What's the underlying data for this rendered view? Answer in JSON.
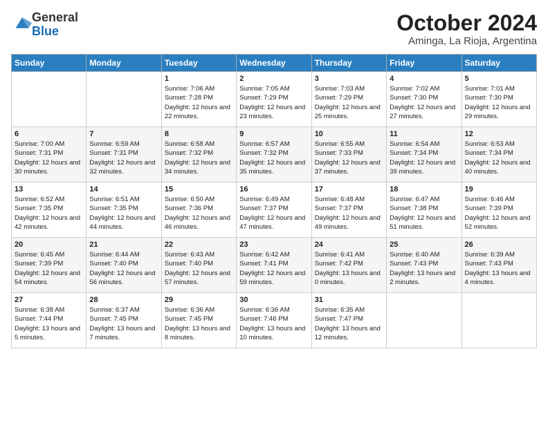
{
  "logo": {
    "general": "General",
    "blue": "Blue"
  },
  "title": "October 2024",
  "subtitle": "Aminga, La Rioja, Argentina",
  "days_of_week": [
    "Sunday",
    "Monday",
    "Tuesday",
    "Wednesday",
    "Thursday",
    "Friday",
    "Saturday"
  ],
  "weeks": [
    [
      {
        "day": "",
        "sunrise": "",
        "sunset": "",
        "daylight": ""
      },
      {
        "day": "",
        "sunrise": "",
        "sunset": "",
        "daylight": ""
      },
      {
        "day": "1",
        "sunrise": "Sunrise: 7:06 AM",
        "sunset": "Sunset: 7:28 PM",
        "daylight": "Daylight: 12 hours and 22 minutes."
      },
      {
        "day": "2",
        "sunrise": "Sunrise: 7:05 AM",
        "sunset": "Sunset: 7:29 PM",
        "daylight": "Daylight: 12 hours and 23 minutes."
      },
      {
        "day": "3",
        "sunrise": "Sunrise: 7:03 AM",
        "sunset": "Sunset: 7:29 PM",
        "daylight": "Daylight: 12 hours and 25 minutes."
      },
      {
        "day": "4",
        "sunrise": "Sunrise: 7:02 AM",
        "sunset": "Sunset: 7:30 PM",
        "daylight": "Daylight: 12 hours and 27 minutes."
      },
      {
        "day": "5",
        "sunrise": "Sunrise: 7:01 AM",
        "sunset": "Sunset: 7:30 PM",
        "daylight": "Daylight: 12 hours and 29 minutes."
      }
    ],
    [
      {
        "day": "6",
        "sunrise": "Sunrise: 7:00 AM",
        "sunset": "Sunset: 7:31 PM",
        "daylight": "Daylight: 12 hours and 30 minutes."
      },
      {
        "day": "7",
        "sunrise": "Sunrise: 6:59 AM",
        "sunset": "Sunset: 7:31 PM",
        "daylight": "Daylight: 12 hours and 32 minutes."
      },
      {
        "day": "8",
        "sunrise": "Sunrise: 6:58 AM",
        "sunset": "Sunset: 7:32 PM",
        "daylight": "Daylight: 12 hours and 34 minutes."
      },
      {
        "day": "9",
        "sunrise": "Sunrise: 6:57 AM",
        "sunset": "Sunset: 7:32 PM",
        "daylight": "Daylight: 12 hours and 35 minutes."
      },
      {
        "day": "10",
        "sunrise": "Sunrise: 6:55 AM",
        "sunset": "Sunset: 7:33 PM",
        "daylight": "Daylight: 12 hours and 37 minutes."
      },
      {
        "day": "11",
        "sunrise": "Sunrise: 6:54 AM",
        "sunset": "Sunset: 7:34 PM",
        "daylight": "Daylight: 12 hours and 39 minutes."
      },
      {
        "day": "12",
        "sunrise": "Sunrise: 6:53 AM",
        "sunset": "Sunset: 7:34 PM",
        "daylight": "Daylight: 12 hours and 40 minutes."
      }
    ],
    [
      {
        "day": "13",
        "sunrise": "Sunrise: 6:52 AM",
        "sunset": "Sunset: 7:35 PM",
        "daylight": "Daylight: 12 hours and 42 minutes."
      },
      {
        "day": "14",
        "sunrise": "Sunrise: 6:51 AM",
        "sunset": "Sunset: 7:35 PM",
        "daylight": "Daylight: 12 hours and 44 minutes."
      },
      {
        "day": "15",
        "sunrise": "Sunrise: 6:50 AM",
        "sunset": "Sunset: 7:36 PM",
        "daylight": "Daylight: 12 hours and 46 minutes."
      },
      {
        "day": "16",
        "sunrise": "Sunrise: 6:49 AM",
        "sunset": "Sunset: 7:37 PM",
        "daylight": "Daylight: 12 hours and 47 minutes."
      },
      {
        "day": "17",
        "sunrise": "Sunrise: 6:48 AM",
        "sunset": "Sunset: 7:37 PM",
        "daylight": "Daylight: 12 hours and 49 minutes."
      },
      {
        "day": "18",
        "sunrise": "Sunrise: 6:47 AM",
        "sunset": "Sunset: 7:38 PM",
        "daylight": "Daylight: 12 hours and 51 minutes."
      },
      {
        "day": "19",
        "sunrise": "Sunrise: 6:46 AM",
        "sunset": "Sunset: 7:39 PM",
        "daylight": "Daylight: 12 hours and 52 minutes."
      }
    ],
    [
      {
        "day": "20",
        "sunrise": "Sunrise: 6:45 AM",
        "sunset": "Sunset: 7:39 PM",
        "daylight": "Daylight: 12 hours and 54 minutes."
      },
      {
        "day": "21",
        "sunrise": "Sunrise: 6:44 AM",
        "sunset": "Sunset: 7:40 PM",
        "daylight": "Daylight: 12 hours and 56 minutes."
      },
      {
        "day": "22",
        "sunrise": "Sunrise: 6:43 AM",
        "sunset": "Sunset: 7:40 PM",
        "daylight": "Daylight: 12 hours and 57 minutes."
      },
      {
        "day": "23",
        "sunrise": "Sunrise: 6:42 AM",
        "sunset": "Sunset: 7:41 PM",
        "daylight": "Daylight: 12 hours and 59 minutes."
      },
      {
        "day": "24",
        "sunrise": "Sunrise: 6:41 AM",
        "sunset": "Sunset: 7:42 PM",
        "daylight": "Daylight: 13 hours and 0 minutes."
      },
      {
        "day": "25",
        "sunrise": "Sunrise: 6:40 AM",
        "sunset": "Sunset: 7:43 PM",
        "daylight": "Daylight: 13 hours and 2 minutes."
      },
      {
        "day": "26",
        "sunrise": "Sunrise: 6:39 AM",
        "sunset": "Sunset: 7:43 PM",
        "daylight": "Daylight: 13 hours and 4 minutes."
      }
    ],
    [
      {
        "day": "27",
        "sunrise": "Sunrise: 6:38 AM",
        "sunset": "Sunset: 7:44 PM",
        "daylight": "Daylight: 13 hours and 5 minutes."
      },
      {
        "day": "28",
        "sunrise": "Sunrise: 6:37 AM",
        "sunset": "Sunset: 7:45 PM",
        "daylight": "Daylight: 13 hours and 7 minutes."
      },
      {
        "day": "29",
        "sunrise": "Sunrise: 6:36 AM",
        "sunset": "Sunset: 7:45 PM",
        "daylight": "Daylight: 13 hours and 8 minutes."
      },
      {
        "day": "30",
        "sunrise": "Sunrise: 6:36 AM",
        "sunset": "Sunset: 7:46 PM",
        "daylight": "Daylight: 13 hours and 10 minutes."
      },
      {
        "day": "31",
        "sunrise": "Sunrise: 6:35 AM",
        "sunset": "Sunset: 7:47 PM",
        "daylight": "Daylight: 13 hours and 12 minutes."
      },
      {
        "day": "",
        "sunrise": "",
        "sunset": "",
        "daylight": ""
      },
      {
        "day": "",
        "sunrise": "",
        "sunset": "",
        "daylight": ""
      }
    ]
  ]
}
